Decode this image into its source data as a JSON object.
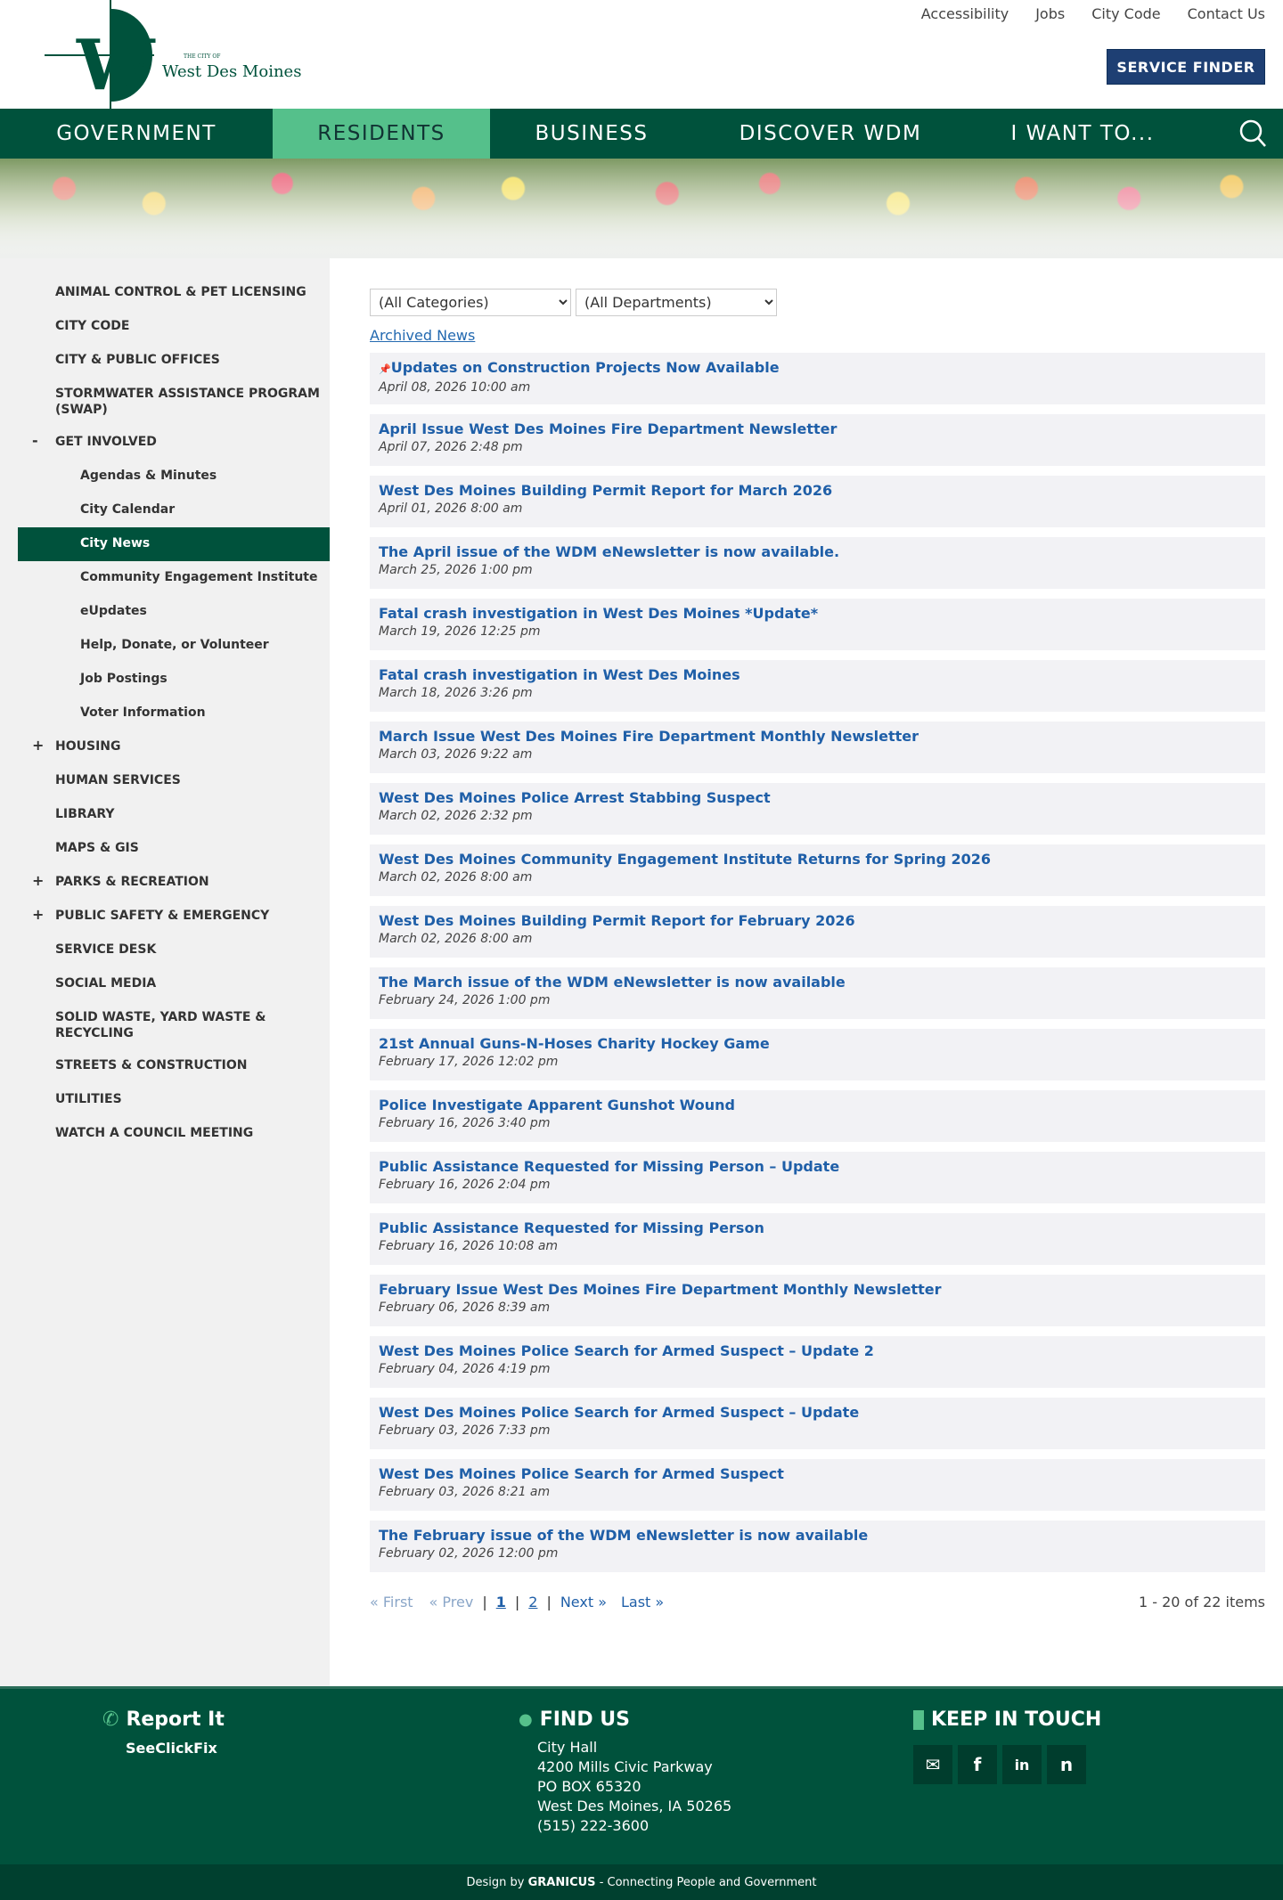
{
  "header": {
    "logo_text_small": "THE CITY OF",
    "logo_text": "West Des Moines",
    "top_links": [
      "Accessibility",
      "Jobs",
      "City Code",
      "Contact Us"
    ],
    "service_finder": "SERVICE FINDER"
  },
  "nav": {
    "items": [
      "GOVERNMENT",
      "RESIDENTS",
      "BUSINESS",
      "DISCOVER WDM",
      "I WANT TO..."
    ],
    "active": "RESIDENTS"
  },
  "sidebar": {
    "items": [
      {
        "label": "ANIMAL CONTROL & PET LICENSING"
      },
      {
        "label": "CITY CODE"
      },
      {
        "label": "CITY & PUBLIC OFFICES"
      },
      {
        "label": "STORMWATER ASSISTANCE PROGRAM (SWAP)"
      },
      {
        "label": "GET INVOLVED",
        "toggle": "-"
      },
      {
        "label": "Agendas & Minutes",
        "sub": true
      },
      {
        "label": "City Calendar",
        "sub": true
      },
      {
        "label": "City News",
        "sub": true,
        "active": true
      },
      {
        "label": "Community Engagement Institute",
        "sub": true
      },
      {
        "label": "eUpdates",
        "sub": true
      },
      {
        "label": "Help, Donate, or Volunteer",
        "sub": true
      },
      {
        "label": "Job Postings",
        "sub": true
      },
      {
        "label": "Voter Information",
        "sub": true
      },
      {
        "label": "HOUSING",
        "toggle": "+"
      },
      {
        "label": "HUMAN SERVICES"
      },
      {
        "label": "LIBRARY"
      },
      {
        "label": "MAPS & GIS"
      },
      {
        "label": "PARKS & RECREATION",
        "toggle": "+"
      },
      {
        "label": "PUBLIC SAFETY & EMERGENCY",
        "toggle": "+"
      },
      {
        "label": "SERVICE DESK"
      },
      {
        "label": "SOCIAL MEDIA"
      },
      {
        "label": "SOLID WASTE, YARD WASTE & RECYCLING"
      },
      {
        "label": "STREETS & CONSTRUCTION"
      },
      {
        "label": "UTILITIES"
      },
      {
        "label": "WATCH A COUNCIL MEETING"
      }
    ]
  },
  "filters": {
    "category": "(All Categories)",
    "department": "(All Departments)"
  },
  "archived_label": "Archived News",
  "news": [
    {
      "title": "Updates on Construction Projects Now Available",
      "date": "April 08, 2026 10:00 am",
      "pinned": true
    },
    {
      "title": "April Issue West Des Moines Fire Department Newsletter",
      "date": "April 07, 2026 2:48 pm"
    },
    {
      "title": "West Des Moines Building Permit Report for March 2026",
      "date": "April 01, 2026 8:00 am"
    },
    {
      "title": "The April issue of the WDM eNewsletter is now available.",
      "date": "March 25, 2026 1:00 pm"
    },
    {
      "title": "Fatal crash investigation in West Des Moines *Update*",
      "date": "March 19, 2026 12:25 pm"
    },
    {
      "title": "Fatal crash investigation in West Des Moines",
      "date": "March 18, 2026 3:26 pm"
    },
    {
      "title": "March Issue West Des Moines Fire Department Monthly Newsletter",
      "date": "March 03, 2026 9:22 am"
    },
    {
      "title": "West Des Moines Police Arrest Stabbing Suspect",
      "date": "March 02, 2026 2:32 pm"
    },
    {
      "title": "West Des Moines Community Engagement Institute Returns for Spring 2026",
      "date": "March 02, 2026 8:00 am"
    },
    {
      "title": "West Des Moines Building Permit Report for February 2026",
      "date": "March 02, 2026 8:00 am"
    },
    {
      "title": "The March issue of the WDM eNewsletter is now available",
      "date": "February 24, 2026 1:00 pm"
    },
    {
      "title": "21st Annual Guns-N-Hoses Charity Hockey Game",
      "date": "February 17, 2026 12:02 pm"
    },
    {
      "title": "Police Investigate Apparent Gunshot Wound",
      "date": "February 16, 2026 3:40 pm"
    },
    {
      "title": "Public Assistance Requested for Missing Person – Update",
      "date": "February 16, 2026 2:04 pm"
    },
    {
      "title": "Public Assistance Requested for Missing Person",
      "date": "February 16, 2026 10:08 am"
    },
    {
      "title": "February Issue West Des Moines Fire Department Monthly Newsletter",
      "date": "February 06, 2026 8:39 am"
    },
    {
      "title": "West Des Moines Police Search for Armed Suspect – Update 2",
      "date": "February 04, 2026 4:19 pm"
    },
    {
      "title": "West Des Moines Police Search for Armed Suspect – Update",
      "date": "February 03, 2026 7:33 pm"
    },
    {
      "title": "West Des Moines Police Search for Armed Suspect",
      "date": "February 03, 2026 8:21 am"
    },
    {
      "title": "The February issue of the WDM eNewsletter is now available",
      "date": "February 02, 2026 12:00 pm"
    }
  ],
  "pager": {
    "first": "« First",
    "prev": "« Prev",
    "pages": [
      "1",
      "2"
    ],
    "sep": "|",
    "next": "Next »",
    "last": "Last »",
    "count": "1 - 20 of 22 items"
  },
  "footer": {
    "report": {
      "title": "Report It",
      "link": "SeeClickFix"
    },
    "find": {
      "title": "FIND US",
      "lines": [
        "City Hall",
        "4200 Mills Civic Parkway",
        "PO BOX 65320",
        "West Des Moines, IA 50265",
        "(515) 222-3600"
      ]
    },
    "keep": {
      "title": "KEEP IN TOUCH",
      "icons": [
        "email-icon",
        "facebook-icon",
        "linkedin-icon",
        "nextdoor-icon"
      ]
    },
    "bottom_prefix": "Design by",
    "bottom_brand": "GRANICUS",
    "bottom_suffix": "- Connecting People and Government"
  },
  "colors": {
    "brand": "#00523c",
    "accent": "#55c08b",
    "link": "#1f5fa8",
    "button": "#1e3f73"
  }
}
